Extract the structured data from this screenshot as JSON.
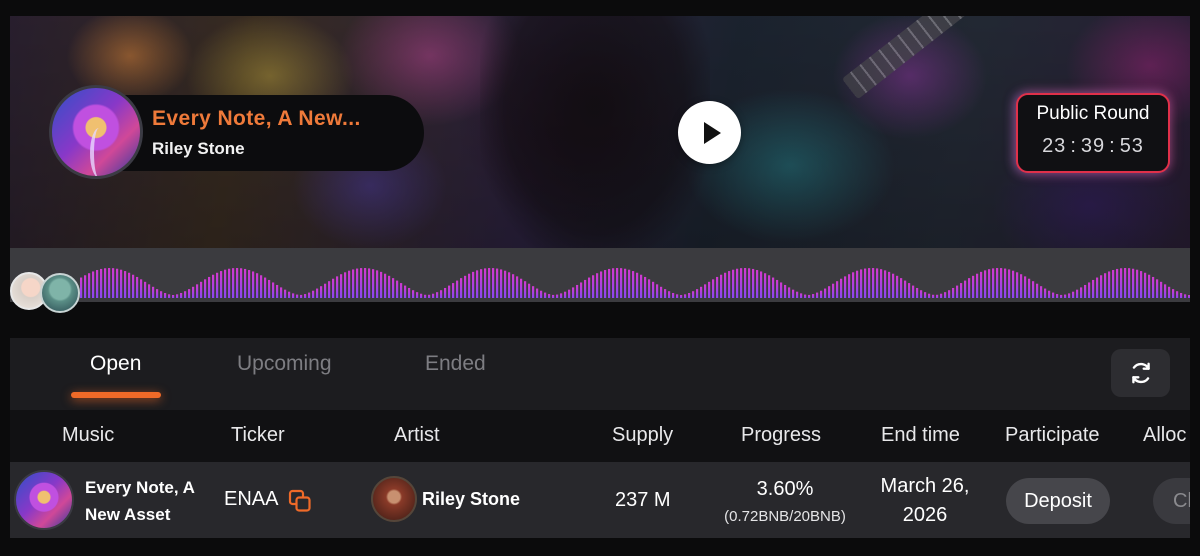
{
  "hero": {
    "song_title": "Every Note, A New...",
    "artist": "Riley Stone",
    "round_label": "Public Round",
    "timer": {
      "hours": "23",
      "minutes": "39",
      "seconds": "53"
    }
  },
  "tabs": [
    {
      "label": "Open",
      "active": true
    },
    {
      "label": "Upcoming",
      "active": false
    },
    {
      "label": "Ended",
      "active": false
    }
  ],
  "table": {
    "headers": [
      "Music",
      "Ticker",
      "Artist",
      "Supply",
      "Progress",
      "End time",
      "Participate",
      "Alloc"
    ],
    "rows": [
      {
        "music": "Every Note, A New Asset",
        "ticker": "ENAA",
        "artist": "Riley Stone",
        "supply": "237 M",
        "progress": "3.60%",
        "progress_detail": "(0.72BNB/20BNB)",
        "end_time": "March 26, 2026",
        "participate": "Deposit",
        "alloc": "Claim"
      }
    ]
  },
  "colors": {
    "accent_orange": "#ef6a28",
    "title_orange": "#ef7a3a",
    "wave_magenta": "#d23ad0",
    "wave_violet": "#8a46f0",
    "round_border": "#e0304a"
  },
  "icons": [
    "play-icon",
    "refresh-icon",
    "copy-icon"
  ]
}
